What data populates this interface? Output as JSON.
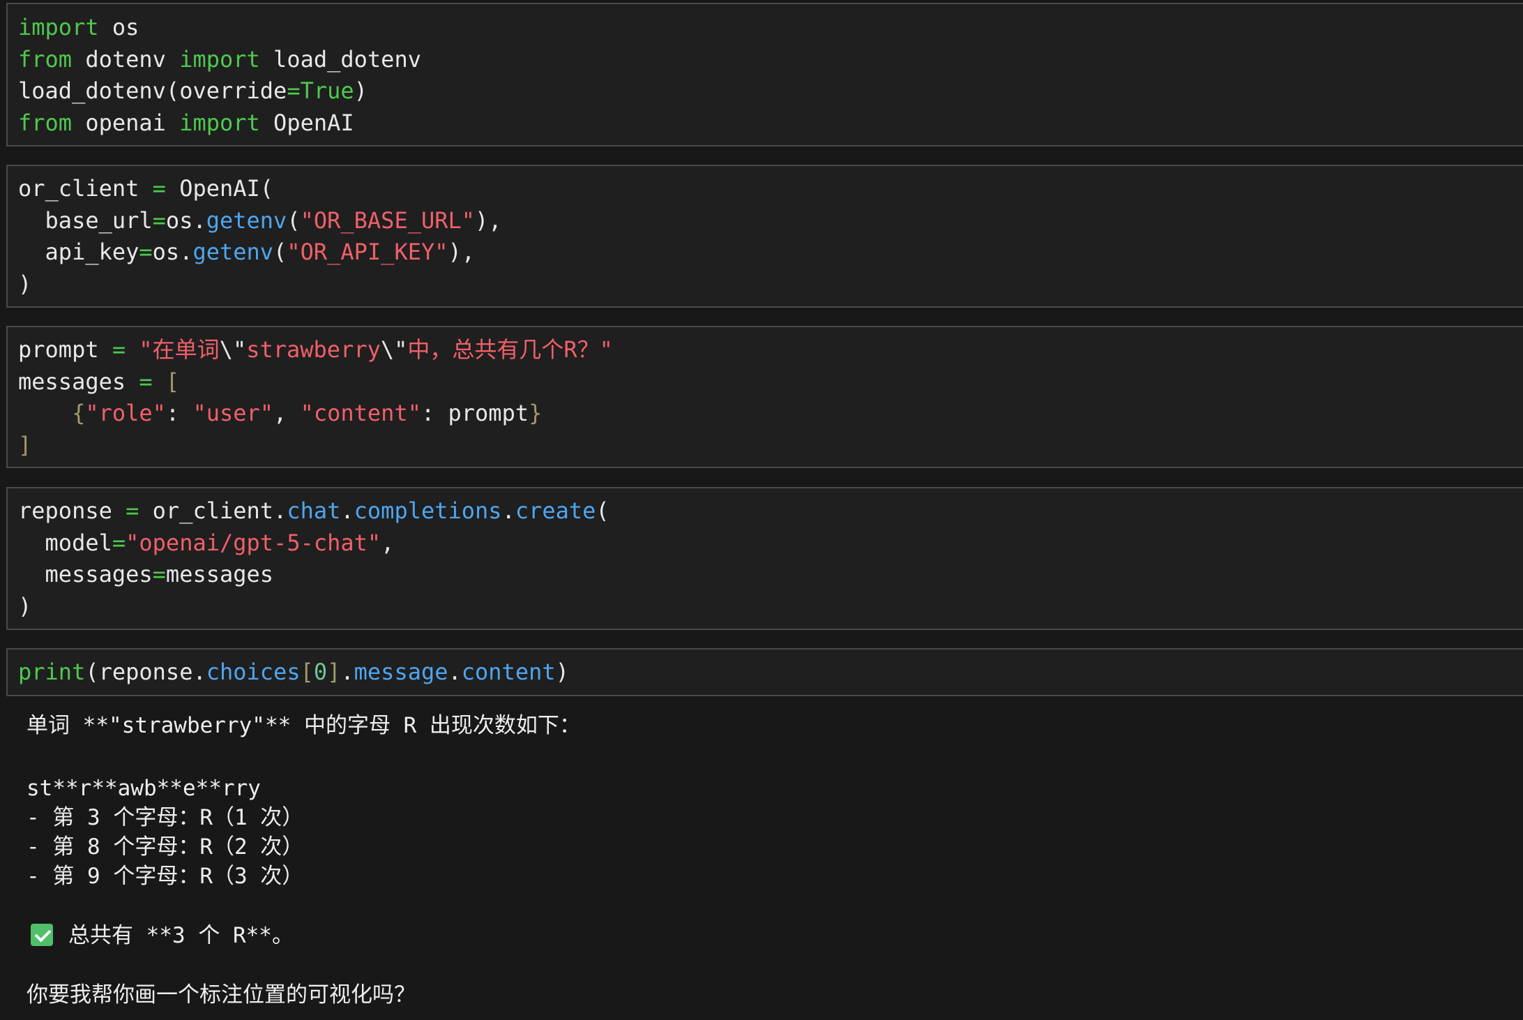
{
  "cells": [
    {
      "lines": [
        [
          {
            "t": "import",
            "c": "kw"
          },
          {
            "t": " os",
            "c": ""
          }
        ],
        [
          {
            "t": "from",
            "c": "kw"
          },
          {
            "t": " dotenv ",
            "c": ""
          },
          {
            "t": "import",
            "c": "kw"
          },
          {
            "t": " load_dotenv",
            "c": ""
          }
        ],
        [
          {
            "t": "load_dotenv(override",
            "c": ""
          },
          {
            "t": "=",
            "c": "kw"
          },
          {
            "t": "True",
            "c": "kw"
          },
          {
            "t": ")",
            "c": ""
          }
        ],
        [
          {
            "t": "from",
            "c": "kw"
          },
          {
            "t": " openai ",
            "c": ""
          },
          {
            "t": "import",
            "c": "kw"
          },
          {
            "t": " OpenAI",
            "c": ""
          }
        ]
      ]
    },
    {
      "lines": [
        [
          {
            "t": "or_client ",
            "c": ""
          },
          {
            "t": "=",
            "c": "kw"
          },
          {
            "t": " OpenAI(",
            "c": ""
          }
        ],
        [
          {
            "t": "  base_url",
            "c": ""
          },
          {
            "t": "=",
            "c": "kw"
          },
          {
            "t": "os.",
            "c": ""
          },
          {
            "t": "getenv",
            "c": "fn"
          },
          {
            "t": "(",
            "c": ""
          },
          {
            "t": "\"OR_BASE_URL\"",
            "c": "str"
          },
          {
            "t": "),",
            "c": ""
          }
        ],
        [
          {
            "t": "  api_key",
            "c": ""
          },
          {
            "t": "=",
            "c": "kw"
          },
          {
            "t": "os.",
            "c": ""
          },
          {
            "t": "getenv",
            "c": "fn"
          },
          {
            "t": "(",
            "c": ""
          },
          {
            "t": "\"OR_API_KEY\"",
            "c": "str"
          },
          {
            "t": "),",
            "c": ""
          }
        ],
        [
          {
            "t": ")",
            "c": ""
          }
        ]
      ]
    },
    {
      "lines": [
        [
          {
            "t": "prompt ",
            "c": ""
          },
          {
            "t": "=",
            "c": "kw"
          },
          {
            "t": " ",
            "c": ""
          },
          {
            "t": "\"在单词",
            "c": "str"
          },
          {
            "t": "\\\"",
            "c": ""
          },
          {
            "t": "strawberry",
            "c": "str"
          },
          {
            "t": "\\\"",
            "c": ""
          },
          {
            "t": "中，总共有几个R？\"",
            "c": "str"
          }
        ],
        [
          {
            "t": "messages ",
            "c": ""
          },
          {
            "t": "=",
            "c": "kw"
          },
          {
            "t": " ",
            "c": ""
          },
          {
            "t": "[",
            "c": "br"
          }
        ],
        [
          {
            "t": "    ",
            "c": ""
          },
          {
            "t": "{",
            "c": "br"
          },
          {
            "t": "\"role\"",
            "c": "str"
          },
          {
            "t": ": ",
            "c": ""
          },
          {
            "t": "\"user\"",
            "c": "str"
          },
          {
            "t": ", ",
            "c": ""
          },
          {
            "t": "\"content\"",
            "c": "str"
          },
          {
            "t": ": prompt",
            "c": ""
          },
          {
            "t": "}",
            "c": "br"
          }
        ],
        [
          {
            "t": "]",
            "c": "br"
          }
        ]
      ]
    },
    {
      "lines": [
        [
          {
            "t": "reponse ",
            "c": ""
          },
          {
            "t": "=",
            "c": "kw"
          },
          {
            "t": " or_client.",
            "c": ""
          },
          {
            "t": "chat",
            "c": "fn"
          },
          {
            "t": ".",
            "c": ""
          },
          {
            "t": "completions",
            "c": "fn"
          },
          {
            "t": ".",
            "c": ""
          },
          {
            "t": "create",
            "c": "fn"
          },
          {
            "t": "(",
            "c": ""
          }
        ],
        [
          {
            "t": "  model",
            "c": ""
          },
          {
            "t": "=",
            "c": "kw"
          },
          {
            "t": "\"openai/gpt-5-chat\"",
            "c": "str"
          },
          {
            "t": ",",
            "c": ""
          }
        ],
        [
          {
            "t": "  messages",
            "c": ""
          },
          {
            "t": "=",
            "c": "kw"
          },
          {
            "t": "messages",
            "c": ""
          }
        ],
        [
          {
            "t": ")",
            "c": ""
          }
        ]
      ]
    },
    {
      "lines": [
        [
          {
            "t": "print",
            "c": "kw"
          },
          {
            "t": "(reponse.",
            "c": ""
          },
          {
            "t": "choices",
            "c": "fn"
          },
          {
            "t": "[",
            "c": "br"
          },
          {
            "t": "0",
            "c": "num"
          },
          {
            "t": "]",
            "c": "br"
          },
          {
            "t": ".",
            "c": ""
          },
          {
            "t": "message",
            "c": "fn"
          },
          {
            "t": ".",
            "c": ""
          },
          {
            "t": "content",
            "c": "fn"
          },
          {
            "t": ")",
            "c": ""
          }
        ]
      ]
    }
  ],
  "output": {
    "line1": "单词 **\"strawberry\"** 中的字母 R 出现次数如下：",
    "line2": "st**r**awb**e**rry",
    "line3": "- 第 3 个字母：R（1 次）",
    "line4": "- 第 8 个字母：R（2 次）",
    "line5": "- 第 9 个字母：R（3 次）",
    "line6": "总共有 **3 个 R**。",
    "line7": "你要我帮你画一个标注位置的可视化吗？",
    "check_icon": "check-mark-icon"
  }
}
